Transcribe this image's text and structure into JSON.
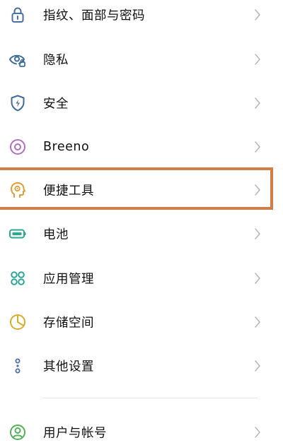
{
  "colors": {
    "highlight_border": "#d57c45",
    "chevron": "#b8b8b8",
    "text": "#111111"
  },
  "settings": {
    "items": [
      {
        "label": "指纹、面部与密码",
        "icon": "lock-icon",
        "icon_color": "#4a6fa5"
      },
      {
        "label": "隐私",
        "icon": "privacy-eye-icon",
        "icon_color": "#3d6d9a"
      },
      {
        "label": "安全",
        "icon": "shield-icon",
        "icon_color": "#3f6b99"
      },
      {
        "label": "Breeno",
        "icon": "breeno-icon",
        "icon_color": "#b26fc2"
      },
      {
        "label": "便捷工具",
        "icon": "head-tool-icon",
        "icon_color": "#e09c35"
      },
      {
        "label": "电池",
        "icon": "battery-icon",
        "icon_color": "#2aa98e"
      },
      {
        "label": "应用管理",
        "icon": "app-grid-icon",
        "icon_color": "#2ca697"
      },
      {
        "label": "存储空间",
        "icon": "storage-pie-icon",
        "icon_color": "#d9ad2b"
      },
      {
        "label": "其他设置",
        "icon": "more-dots-icon",
        "icon_color": "#4a6fa5"
      },
      {
        "label": "用户与帐号",
        "icon": "user-icon",
        "icon_color": "#52b15a"
      }
    ]
  }
}
